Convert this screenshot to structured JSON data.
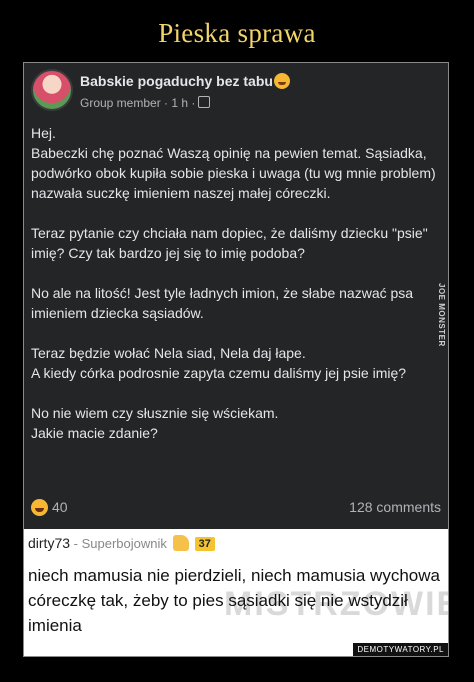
{
  "page_title": "Pieska sprawa",
  "post": {
    "group_name": "Babskie pogaduchy bez tabu",
    "meta": "Group member · 1 h ·",
    "paragraphs": [
      "Hej.\nBabeczki chę poznać Waszą opinię na pewien temat. Sąsiadka, podwórko obok kupiła sobie pieska i uwaga (tu wg mnie problem) nazwała suczkę imieniem naszej małej córeczki.",
      "Teraz pytanie czy chciała nam dopiec, że daliśmy dziecku \"psie\" imię? Czy tak bardzo jej się to imię podoba?",
      "No ale na litość! Jest tyle ładnych imion, że słabe nazwać psa imieniem dziecka sąsiadów.",
      "Teraz będzie wołać Nela siad, Nela daj łape.\nA kiedy córka podrosnie zapyta czemu daliśmy jej psie imię?",
      "No nie wiem czy słusznie się wściekam.\nJakie macie zdanie?"
    ],
    "reaction_count": "40",
    "comments_count": "128 comments",
    "side_label": "JOE MONSTER"
  },
  "comment": {
    "username": "dirty73",
    "separator": " - ",
    "rank": "Superbojownik",
    "score": "37",
    "text": "niech mamusia nie pierdzieli, niech mamusia wychowa córeczkę tak, żeby to pies sąsiadki się nie wstydził imienia",
    "watermark": "MISTRZOWIE",
    "site_tag": "DEMOTYWATORY.PL"
  },
  "colors": {
    "title": "#f1d46a",
    "post_bg": "#242526",
    "post_text": "#e4e6eb",
    "muted": "#b0b3b8",
    "score_badge": "#f4c430"
  },
  "icons": {
    "group_avatar": "avatar",
    "group_name_emoji": "blushing-face-icon",
    "privacy": "globe-icon",
    "reaction": "laughing-face-icon",
    "rank_badge": "thumbs-up-icon"
  }
}
